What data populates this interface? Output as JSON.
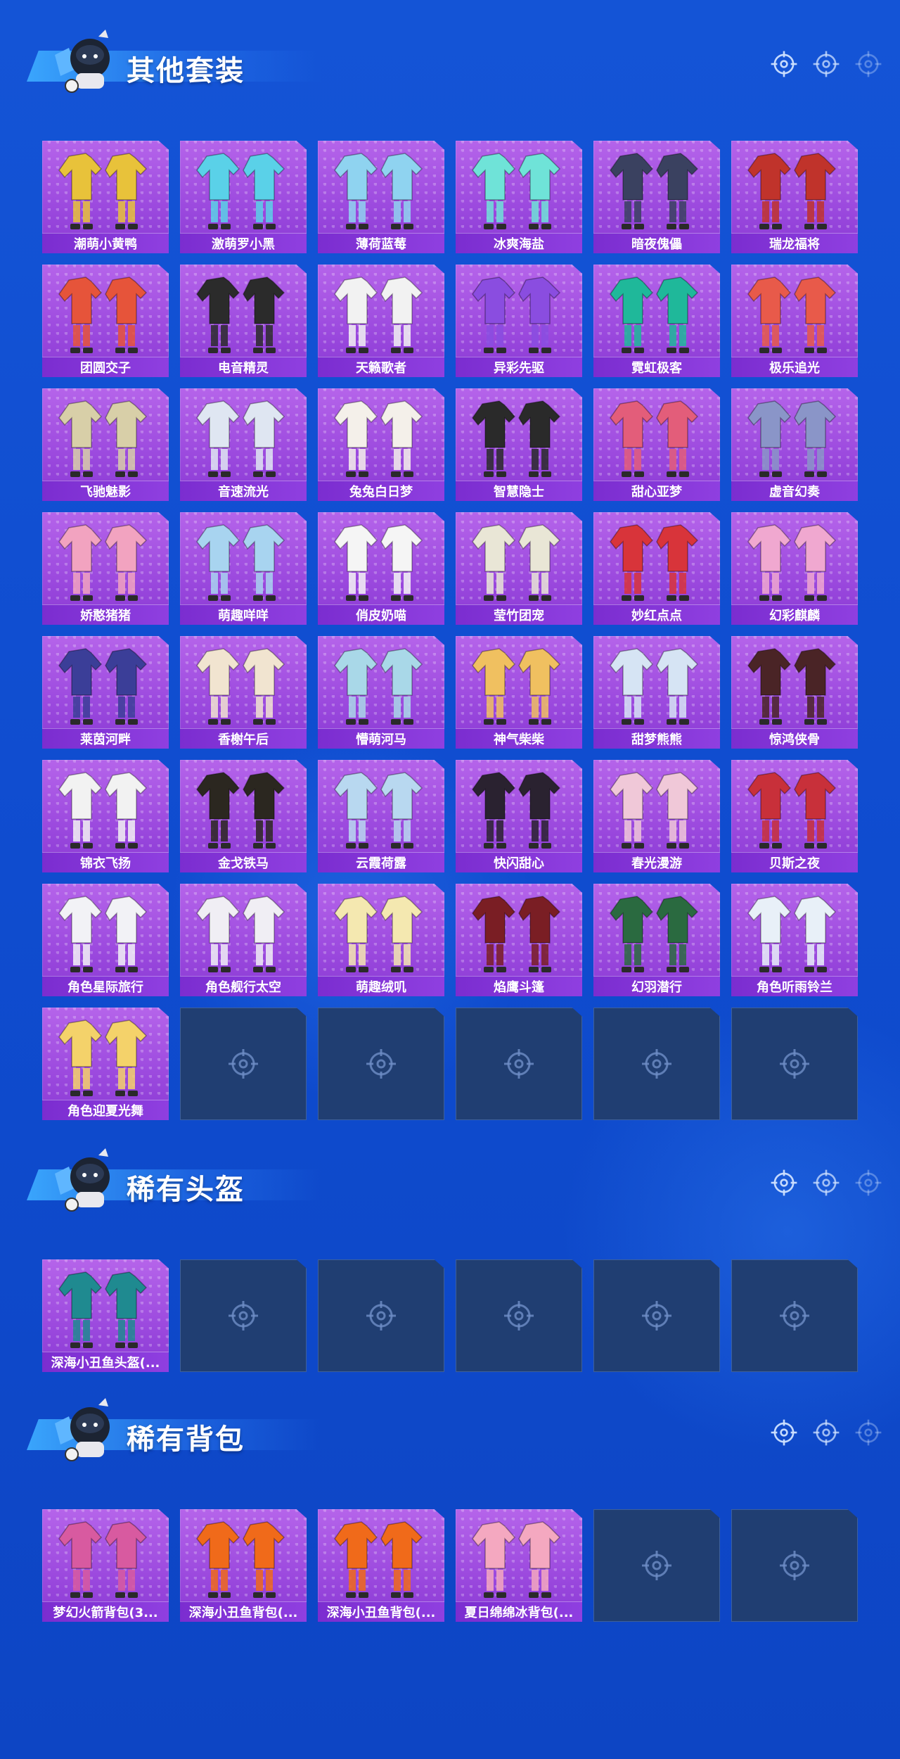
{
  "sections": [
    {
      "title": "其他套装",
      "items": [
        {
          "label": "潮萌小黄鸭",
          "color": "#e8c23a"
        },
        {
          "label": "激萌罗小黑",
          "color": "#5ad1e8"
        },
        {
          "label": "薄荷蓝莓",
          "color": "#8fd3f0"
        },
        {
          "label": "冰爽海盐",
          "color": "#6fe3d8"
        },
        {
          "label": "暗夜傀儡",
          "color": "#3a4160"
        },
        {
          "label": "瑞龙福将",
          "color": "#c0332b"
        },
        {
          "label": "团圆交子",
          "color": "#e6543a"
        },
        {
          "label": "电音精灵",
          "color": "#2b2b2b"
        },
        {
          "label": "天籁歌者",
          "color": "#f2f2f2"
        },
        {
          "label": "异彩先驱",
          "color": "#8a4de0"
        },
        {
          "label": "霓虹极客",
          "color": "#1fb89a"
        },
        {
          "label": "极乐追光",
          "color": "#e85a4a"
        },
        {
          "label": "飞驰魅影",
          "color": "#d8cfa8"
        },
        {
          "label": "音速流光",
          "color": "#dfe6f2"
        },
        {
          "label": "兔兔白日梦",
          "color": "#f4f0ea"
        },
        {
          "label": "智慧隐士",
          "color": "#2a2a2a"
        },
        {
          "label": "甜心亚梦",
          "color": "#e35d7a"
        },
        {
          "label": "虚音幻奏",
          "color": "#8a95c8"
        },
        {
          "label": "娇憨猪猪",
          "color": "#f2a3c0"
        },
        {
          "label": "萌趣咩咩",
          "color": "#a8d4f0"
        },
        {
          "label": "俏皮奶喵",
          "color": "#f5f5f5"
        },
        {
          "label": "莹竹团宠",
          "color": "#e9e6d6"
        },
        {
          "label": "妙红点点",
          "color": "#d8343a"
        },
        {
          "label": "幻彩麒麟",
          "color": "#f0a8d0"
        },
        {
          "label": "莱茵河畔",
          "color": "#3b3e98"
        },
        {
          "label": "香榭午后",
          "color": "#f1e4d0"
        },
        {
          "label": "懵萌河马",
          "color": "#a9d8e8"
        },
        {
          "label": "神气柴柴",
          "color": "#f0c060"
        },
        {
          "label": "甜梦熊熊",
          "color": "#d6e4f4"
        },
        {
          "label": "惊鸿侠骨",
          "color": "#4a2426"
        },
        {
          "label": "锦衣飞扬",
          "color": "#f2f2f2"
        },
        {
          "label": "金戈铁马",
          "color": "#2b2720"
        },
        {
          "label": "云霞荷露",
          "color": "#b8d8f0"
        },
        {
          "label": "快闪甜心",
          "color": "#2a2230"
        },
        {
          "label": "春光漫游",
          "color": "#f0c8d8"
        },
        {
          "label": "贝斯之夜",
          "color": "#c8303a"
        },
        {
          "label": "角色星际旅行",
          "color": "#f2f2f6"
        },
        {
          "label": "角色舰行太空",
          "color": "#f0eef4"
        },
        {
          "label": "萌趣绒叽",
          "color": "#f4e8b0"
        },
        {
          "label": "焰鹰斗篷",
          "color": "#7a1e24"
        },
        {
          "label": "幻羽潜行",
          "color": "#2a6a40"
        },
        {
          "label": "角色听雨铃兰",
          "color": "#e8f0f8"
        },
        {
          "label": "角色迎夏光舞",
          "color": "#f4d26a"
        }
      ],
      "empty_count": 5
    },
    {
      "title": "稀有头盔",
      "items": [
        {
          "label": "深海小丑鱼头盔(...",
          "color": "#1f8a90"
        }
      ],
      "empty_count": 5
    },
    {
      "title": "稀有背包",
      "items": [
        {
          "label": "梦幻火箭背包(3...",
          "color": "#d85aa0"
        },
        {
          "label": "深海小丑鱼背包(...",
          "color": "#f06a1a"
        },
        {
          "label": "深海小丑鱼背包(...",
          "color": "#f06a1a"
        },
        {
          "label": "夏日绵绵冰背包(...",
          "color": "#f4a8c0"
        }
      ],
      "empty_count": 2
    }
  ]
}
